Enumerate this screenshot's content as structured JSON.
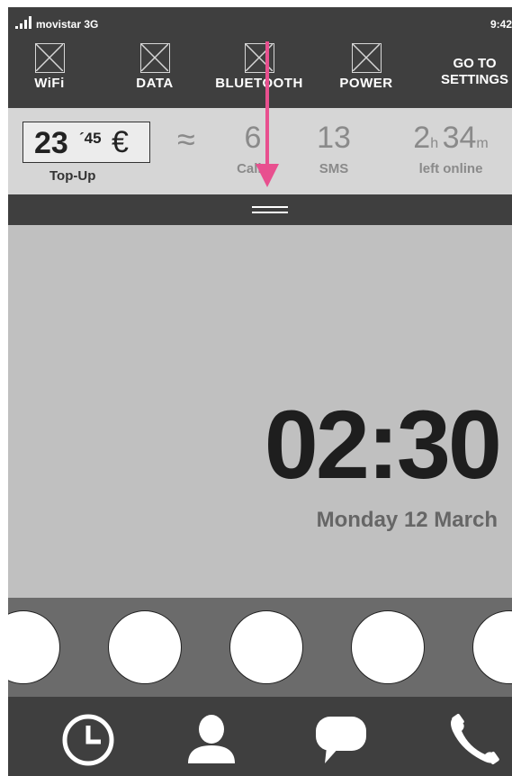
{
  "status": {
    "carrier": "movistar 3G",
    "time": "9:42"
  },
  "toggles": [
    {
      "label": "WiFi"
    },
    {
      "label": "DATA"
    },
    {
      "label": "BLUETOOTH"
    },
    {
      "label": "POWER"
    }
  ],
  "settings": {
    "line1": "GO TO",
    "line2": "SETTINGS"
  },
  "balance": {
    "amount_main": "23",
    "amount_cents": "´45",
    "currency": "€",
    "topup_label": "Top-Up",
    "approx": "≈",
    "calls": {
      "value": "6",
      "label": "Calls"
    },
    "sms": {
      "value": "13",
      "label": "SMS"
    },
    "online": {
      "hours": "2",
      "hours_unit": "h",
      "minutes": "34",
      "minutes_unit": "m",
      "label": "left online"
    }
  },
  "lockscreen": {
    "time": "02:30",
    "date": "Monday 12 March"
  },
  "dock": {
    "slots": 5
  },
  "nav": {
    "icons": [
      "clock-icon",
      "contacts-icon",
      "messages-icon",
      "phone-icon"
    ]
  },
  "colors": {
    "arrow": "#e8508f",
    "dark": "#3f3f3f",
    "background": "#c0c0c0"
  }
}
